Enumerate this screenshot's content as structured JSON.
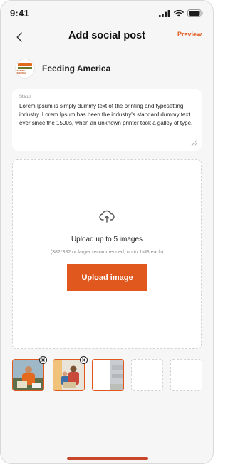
{
  "status_bar": {
    "time": "9:41"
  },
  "header": {
    "title": "Add social post",
    "preview_label": "Preview"
  },
  "organization": {
    "name": "Feeding America",
    "logo_text": "FEEDING AMERICA"
  },
  "status_field": {
    "label": "Status",
    "value": "Lorem Ipsum is simply dummy text of the printing and typesetting industry. Lorem Ipsum has been the industry's standard dummy text ever since the 1500s, when an unknown printer took a galley of type."
  },
  "upload": {
    "title": "Upload up to 5 images",
    "hint": "(382*382 or larger recommended, up to 1MB each)",
    "button_label": "Upload image"
  },
  "thumbnails": [
    {
      "state": "image",
      "removable": true
    },
    {
      "state": "image",
      "removable": true
    },
    {
      "state": "image",
      "removable": false
    },
    {
      "state": "empty",
      "removable": false
    },
    {
      "state": "empty",
      "removable": false
    }
  ],
  "colors": {
    "accent": "#e0581d",
    "background": "#f6f6f6",
    "card": "#ffffff"
  },
  "icons": [
    "signal-icon",
    "wifi-icon",
    "battery-icon",
    "back-arrow-icon",
    "cloud-upload-icon",
    "resize-handle-icon",
    "close-icon"
  ]
}
